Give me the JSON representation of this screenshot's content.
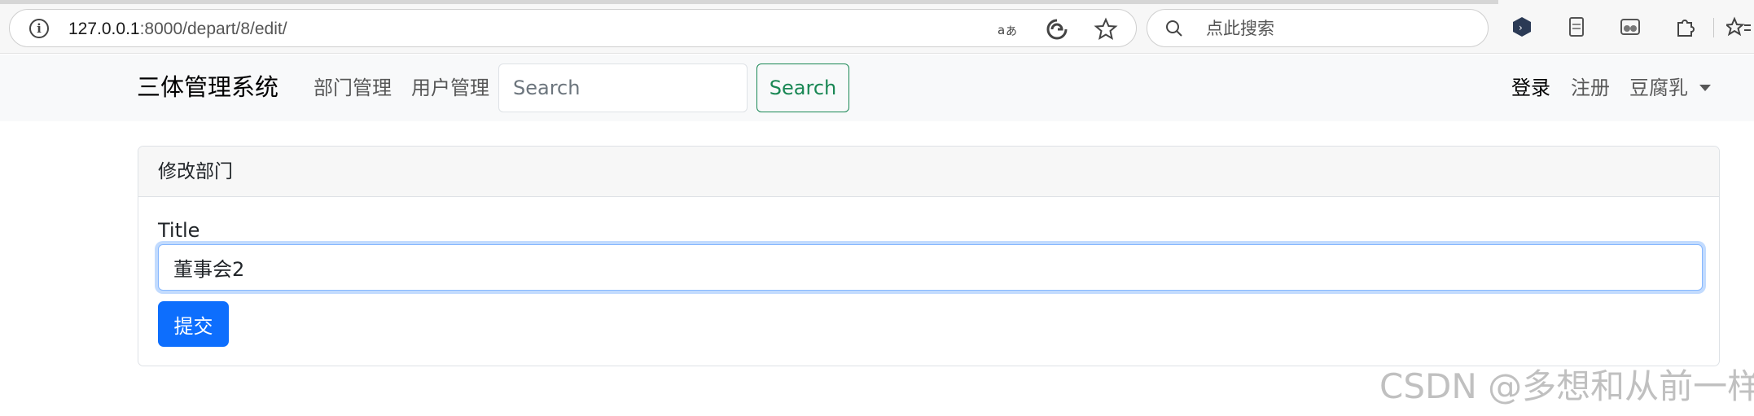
{
  "browser": {
    "url_host": "127.0.0.1",
    "url_rest": ":8000/depart/8/edit/",
    "search_placeholder": "点此搜索",
    "icons": [
      "info-icon",
      "read-aloud-icon",
      "edge-refresh-icon",
      "favorite-star-icon",
      "search-icon",
      "extension-hex-icon",
      "page-icon",
      "collections-icon",
      "puzzle-extensions-icon",
      "favorites-list-icon"
    ]
  },
  "navbar": {
    "brand": "三体管理系统",
    "links": [
      {
        "label": "部门管理"
      },
      {
        "label": "用户管理"
      }
    ],
    "search_placeholder": "Search",
    "search_button": "Search",
    "right": {
      "login": "登录",
      "register": "注册",
      "user": "豆腐乳"
    }
  },
  "card": {
    "header": "修改部门",
    "field_label": "Title",
    "field_value": "董事会2",
    "submit_label": "提交"
  },
  "watermark": "CSDN @多想和从前一样",
  "colors": {
    "primary": "#0d6efd",
    "success": "#198754",
    "navbar_bg": "#f8f9fa",
    "focus_border": "#86b7fe"
  }
}
